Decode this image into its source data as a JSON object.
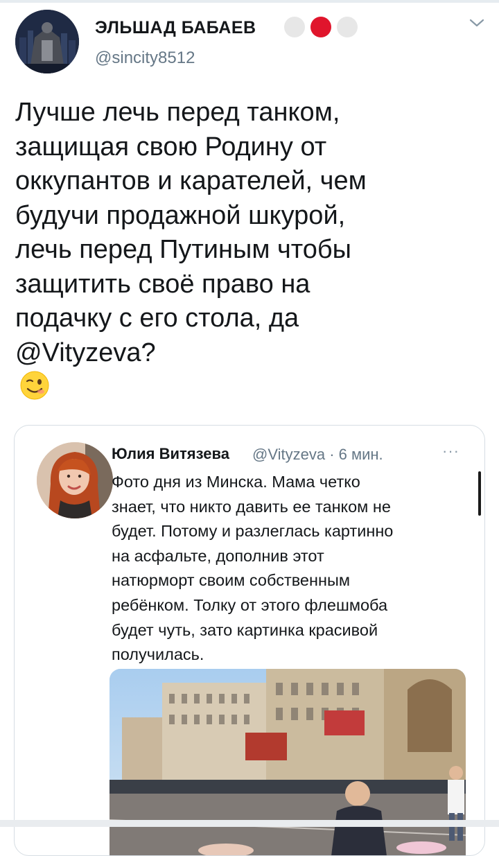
{
  "author": {
    "name": "ЭЛЬШАД БАБАЕВ",
    "handle": "@sincity8512",
    "flag_colors": [
      "#e6e6e6",
      "#e0152c",
      "#e6e6e6"
    ]
  },
  "tweet": {
    "lines": [
      "Лучше лечь перед танком,",
      "защищая свою Родину от",
      "оккупантов и карателей, чем",
      "будучи продажной шкурой,",
      "лечь перед Путиным чтобы",
      "защитить своё право на",
      "подачку с его стола, да",
      "@Vityzeva?"
    ],
    "emoji": "winking-face"
  },
  "quoted": {
    "name": "Юлия Витязева",
    "meta": "@Vityzeva · 6 мин.",
    "more": "···",
    "lines": [
      "Фото дня из Минска. Мама четко",
      "знает, что никто давить ее танком не",
      "будет. Потому и разлеглась картинно",
      "на асфальте, дополнив этот",
      "натюрморт своим собственным",
      "ребёнком. Толку от этого флешмоба",
      "будет чуть, зато картинка красивой",
      "получилась."
    ]
  },
  "icons": {
    "chevron": "chevron-down-icon",
    "avatar": "avatar-image",
    "photo": "street-photo-image"
  }
}
